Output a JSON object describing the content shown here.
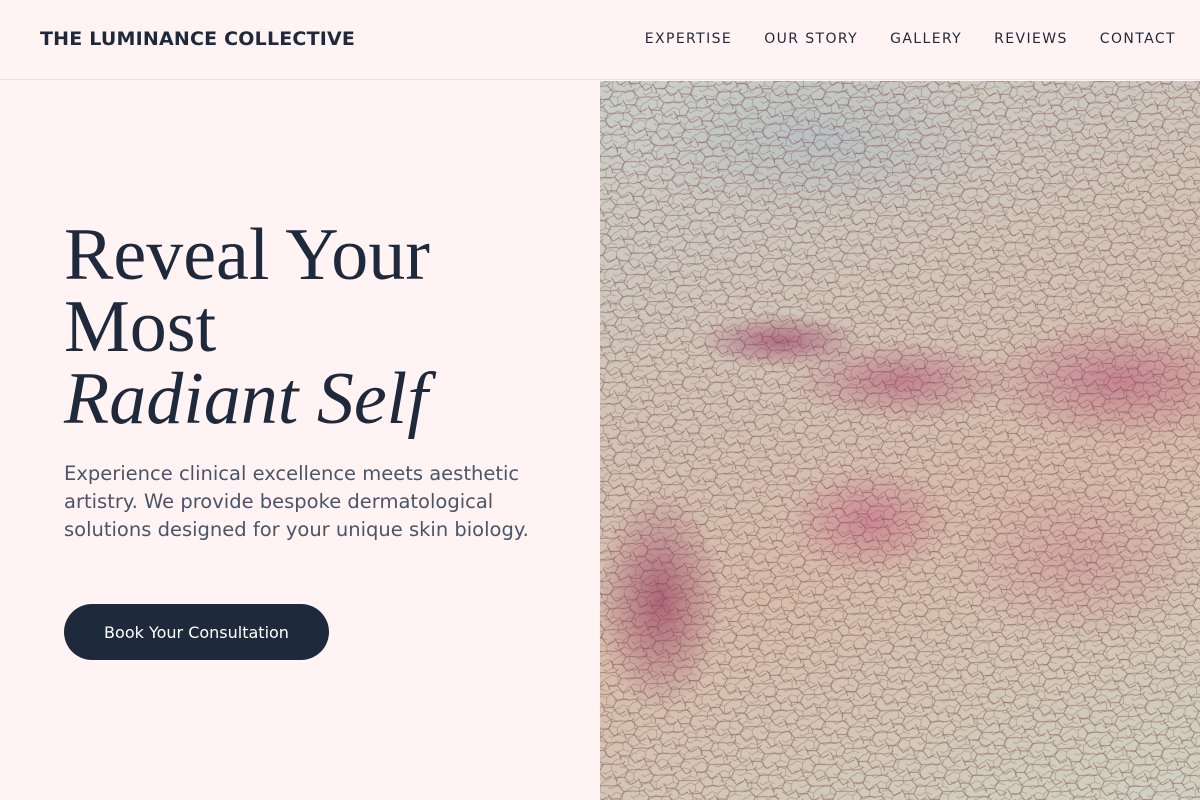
{
  "header": {
    "brand": "THE LUMINANCE COLLECTIVE",
    "nav": [
      "EXPERTISE",
      "OUR STORY",
      "GALLERY",
      "REVIEWS",
      "CONTACT"
    ]
  },
  "hero": {
    "headline_line1": "Reveal Your",
    "headline_line2": "Most",
    "headline_line3": "Radiant Self",
    "subtext": "Experience clinical excellence meets aesthetic artistry. We provide bespoke dermatological solutions designed for your unique skin biology.",
    "cta_label": "Book Your Consultation"
  },
  "colors": {
    "background": "#fff4f3",
    "primary_dark": "#1e293b",
    "text_muted": "#4a5568"
  },
  "icons": {}
}
